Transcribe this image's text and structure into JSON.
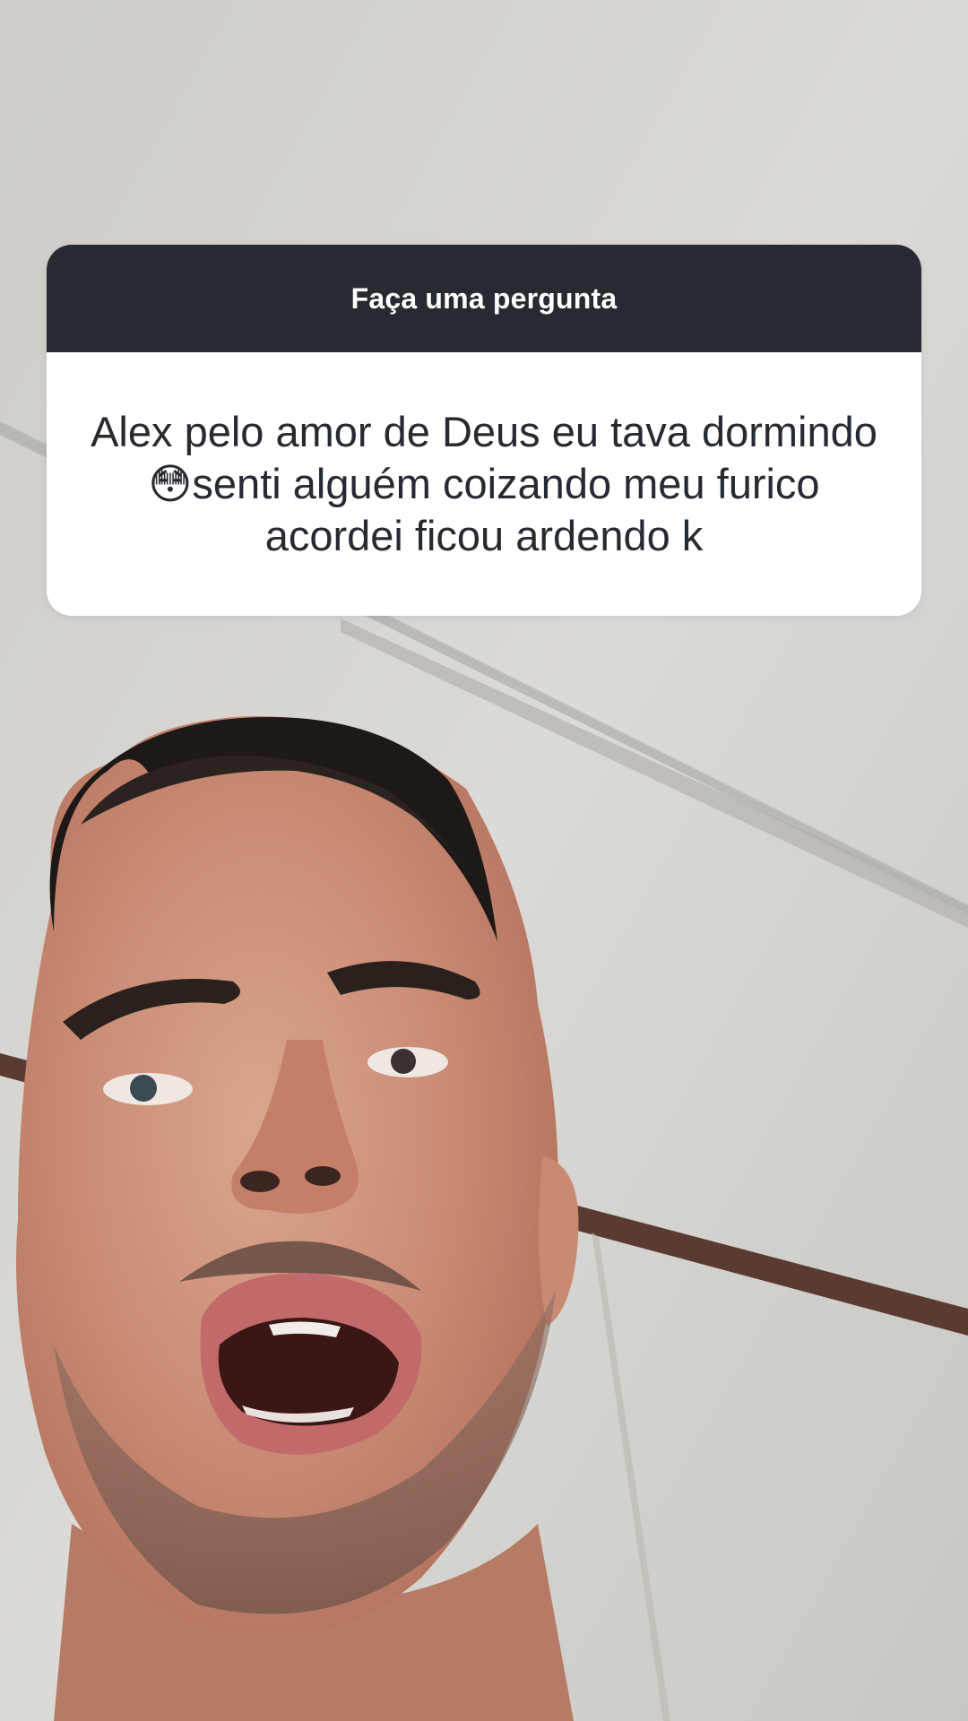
{
  "question_sticker": {
    "title": "Faça uma pergunta",
    "question_text": "Alex pelo amor de Deus eu tava dormindo😳senti alguém coizando meu furico acordei ficou ardendo k"
  },
  "colors": {
    "header_bg": "#262a31",
    "card_bg": "#ffffff",
    "title_text": "#ffffff",
    "body_text": "#262a31",
    "wall": "#d9d7d2"
  },
  "background": {
    "scene": "selfie-video-frame"
  }
}
